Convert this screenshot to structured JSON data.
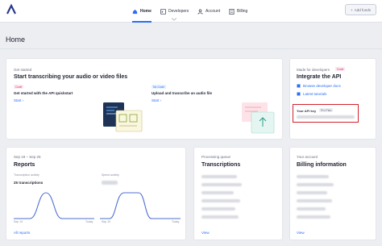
{
  "nav": {
    "home": "Home",
    "developers": "Developers",
    "account": "Account",
    "billing": "Billing",
    "add_funds": "Add funds"
  },
  "page": {
    "title": "Home"
  },
  "get_started": {
    "eyebrow": "Get started",
    "title": "Start transcribing your audio or video files",
    "code_badge": "Code",
    "code_title": "Get started with the API quickstart",
    "code_link": "Start",
    "nocode_badge": "No Code",
    "nocode_title": "Upload and transcribe an audio file",
    "nocode_link": "Start"
  },
  "developers_card": {
    "eyebrow": "Made for developers",
    "badge": "Code",
    "title": "Integrate the API",
    "links": [
      "Browse developer docs",
      "Latest tutorials"
    ],
    "api_key_label": "Your API key",
    "api_key_badge": "Pro Plan"
  },
  "reports": {
    "eyebrow": "Sep 19 – Sep 26",
    "title": "Reports",
    "transcription_label": "Transcription activity",
    "transcription_value": "25 transcriptions",
    "spend_label": "Spend activity",
    "x_start": "Sep 19",
    "x_end": "Today",
    "link": "All reports"
  },
  "queue": {
    "eyebrow": "Processing queue",
    "title": "Transcriptions",
    "link": "View"
  },
  "account_card": {
    "eyebrow": "Your account",
    "title": "Billing information",
    "link": "View"
  },
  "colors": {
    "accent": "#2b6ef5",
    "highlight": "#d3202a",
    "code": "#d3326a"
  }
}
